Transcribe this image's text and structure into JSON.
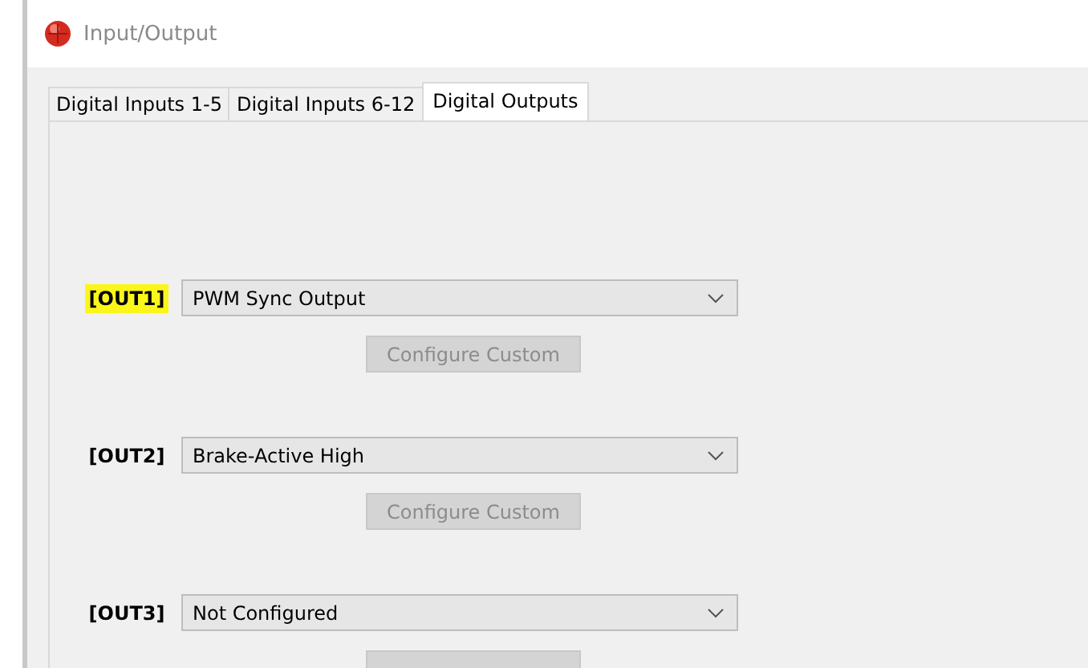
{
  "window": {
    "title": "Input/Output"
  },
  "tabs": [
    {
      "label": "Digital Inputs 1-5",
      "selected": false
    },
    {
      "label": "Digital Inputs 6-12",
      "selected": false
    },
    {
      "label": "Digital Outputs",
      "selected": true
    }
  ],
  "outputs": [
    {
      "label": "[OUT1]",
      "highlighted": true,
      "value": "PWM Sync Output",
      "button": {
        "label": "Configure Custom",
        "disabled": true
      }
    },
    {
      "label": "[OUT2]",
      "highlighted": false,
      "value": "Brake-Active High",
      "button": {
        "label": "Configure Custom",
        "disabled": true
      }
    },
    {
      "label": "[OUT3]",
      "highlighted": false,
      "value": "Not Configured",
      "button": {
        "disabled": true
      }
    }
  ]
}
